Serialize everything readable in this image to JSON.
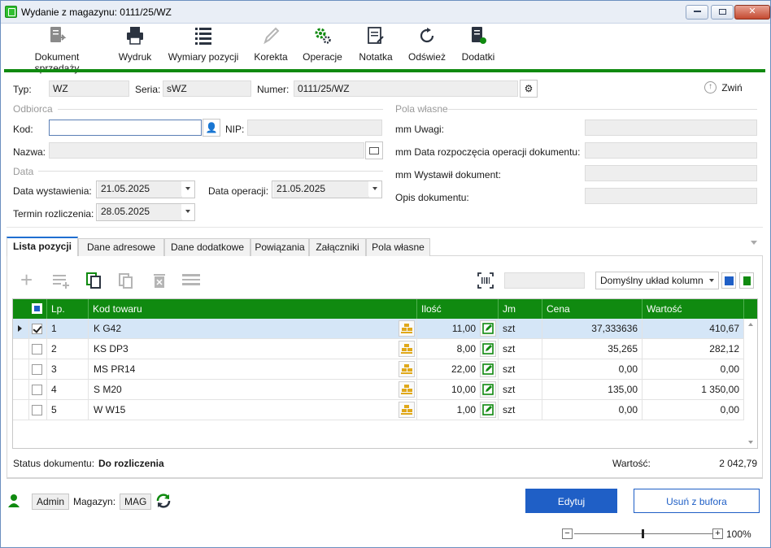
{
  "window": {
    "title": "Wydanie z magazynu: 0111/25/WZ"
  },
  "toolbar": {
    "items": [
      {
        "label": "Dokument sprzedaży",
        "icon": "document-export-icon"
      },
      {
        "label": "Wydruk",
        "icon": "printer-icon"
      },
      {
        "label": "Wymiary pozycji",
        "icon": "list-icon"
      },
      {
        "label": "Korekta",
        "icon": "pencil-icon"
      },
      {
        "label": "Operacje",
        "icon": "gears-icon"
      },
      {
        "label": "Notatka",
        "icon": "note-icon"
      },
      {
        "label": "Odśwież",
        "icon": "refresh-icon"
      },
      {
        "label": "Dodatki",
        "icon": "addons-icon"
      }
    ],
    "accent_color": "#108a10"
  },
  "header": {
    "typ_label": "Typ:",
    "typ_value": "WZ",
    "seria_label": "Seria:",
    "seria_value": "sWZ",
    "numer_label": "Numer:",
    "numer_value": "0111/25/WZ",
    "collapse_label": "Zwiń"
  },
  "odbiorca": {
    "section_label": "Odbiorca",
    "kod_label": "Kod:",
    "kod_value": "",
    "nip_label": "NIP:",
    "nip_value": "",
    "nazwa_label": "Nazwa:",
    "nazwa_value": ""
  },
  "data_section": {
    "section_label": "Data",
    "wystawienia_label": "Data wystawienia:",
    "wystawienia_value": "21.05.2025",
    "operacji_label": "Data operacji:",
    "operacji_value": "21.05.2025",
    "termin_label": "Termin rozliczenia:",
    "termin_value": "28.05.2025"
  },
  "pola_wlasne": {
    "section_label": "Pola własne",
    "fields": [
      {
        "label": "mm Uwagi:",
        "value": ""
      },
      {
        "label": "mm Data rozpoczęcia operacji dokumentu:",
        "value": ""
      },
      {
        "label": "mm Wystawił dokument:",
        "value": ""
      },
      {
        "label": "Opis dokumentu:",
        "value": ""
      }
    ]
  },
  "tabs": [
    {
      "label": "Lista pozycji",
      "active": true
    },
    {
      "label": "Dane adresowe"
    },
    {
      "label": "Dane dodatkowe"
    },
    {
      "label": "Powiązania"
    },
    {
      "label": "Załączniki"
    },
    {
      "label": "Pola własne"
    }
  ],
  "grid_toolbar": {
    "search_value": "",
    "layout_select": "Domyślny układ kolumn"
  },
  "grid": {
    "columns": [
      "Lp.",
      "Kod towaru",
      "Ilość",
      "Jm",
      "Cena",
      "Wartość"
    ],
    "rows": [
      {
        "lp": "1",
        "kod": "K G42",
        "ilosc": "11,00",
        "jm": "szt",
        "cena": "37,333636",
        "wartosc": "410,67",
        "checked": true,
        "selected": true
      },
      {
        "lp": "2",
        "kod": "KS DP3",
        "ilosc": "8,00",
        "jm": "szt",
        "cena": "35,265",
        "wartosc": "282,12"
      },
      {
        "lp": "3",
        "kod": "MS PR14",
        "ilosc": "22,00",
        "jm": "szt",
        "cena": "0,00",
        "wartosc": "0,00"
      },
      {
        "lp": "4",
        "kod": "S M20",
        "ilosc": "10,00",
        "jm": "szt",
        "cena": "135,00",
        "wartosc": "1 350,00"
      },
      {
        "lp": "5",
        "kod": "W W15",
        "ilosc": "1,00",
        "jm": "szt",
        "cena": "0,00",
        "wartosc": "0,00"
      }
    ]
  },
  "footer": {
    "status_label": "Status dokumentu:",
    "status_value": "Do rozliczenia",
    "wartosc_label": "Wartość:",
    "wartosc_value": "2 042,79"
  },
  "bottom": {
    "user": "Admin",
    "magazyn_label": "Magazyn:",
    "magazyn_value": "MAG",
    "edit_button": "Edytuj",
    "remove_button": "Usuń z bufora",
    "zoom": "100%"
  }
}
